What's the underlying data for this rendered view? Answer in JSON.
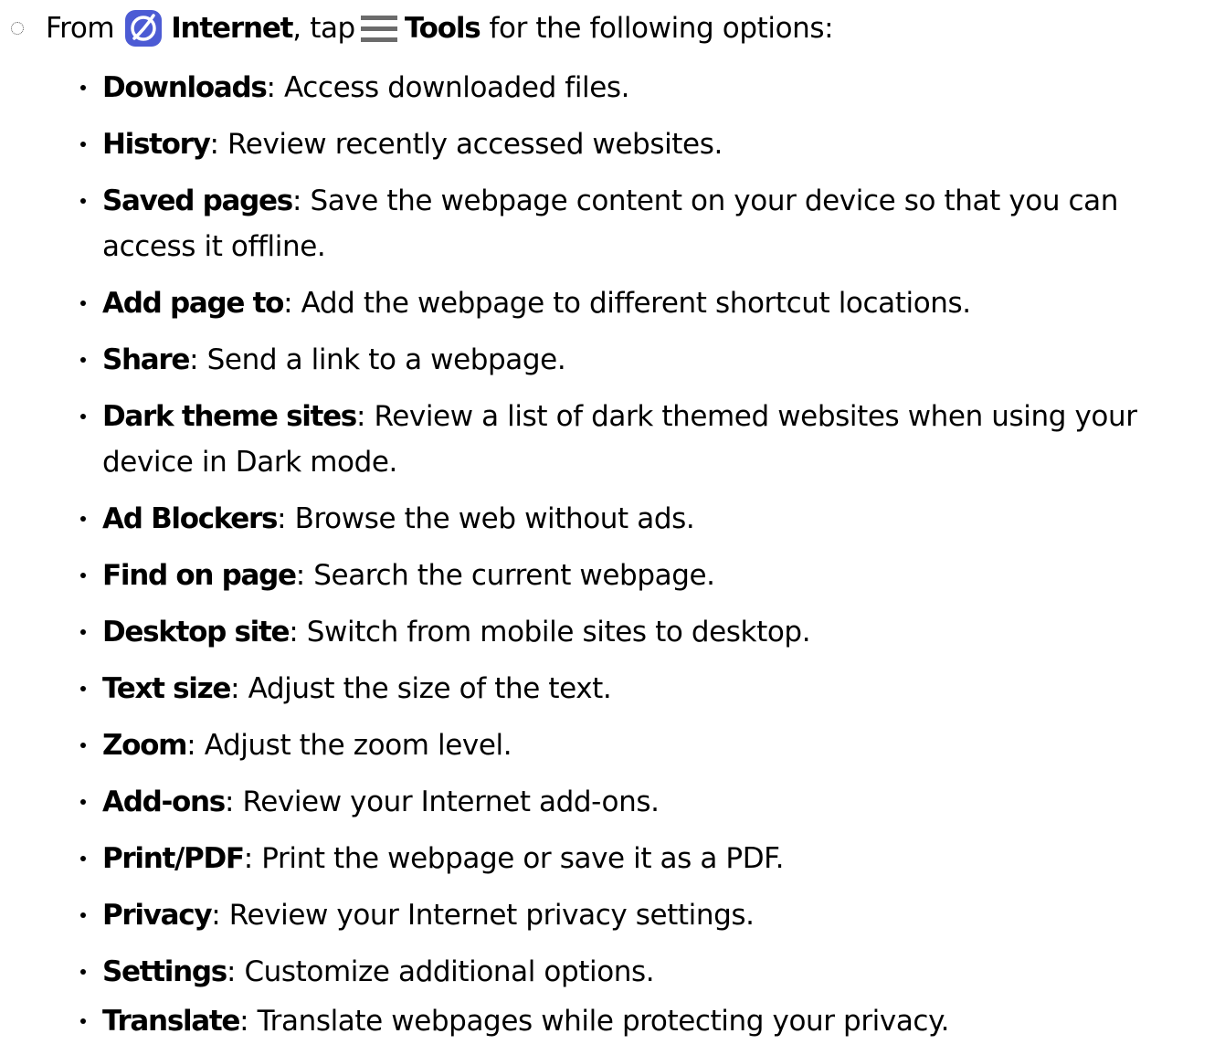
{
  "intro": {
    "from": "From",
    "app_name": "Internet",
    "comma_tap": ", tap",
    "menu_name": "Tools",
    "rest": "for the following options:"
  },
  "icons": {
    "step_marker": "dotted-circle-icon",
    "app": "internet-app-icon",
    "menu": "hamburger-menu-icon"
  },
  "colors": {
    "app_icon_bg": "#4c5bd4",
    "app_icon_ring": "#ffffff",
    "menu_icon": "#6b6b6b"
  },
  "options": [
    {
      "term": "Downloads",
      "desc": "Access downloaded files."
    },
    {
      "term": "History",
      "desc": "Review recently accessed websites."
    },
    {
      "term": "Saved pages",
      "desc": "Save the webpage content on your device so that you can",
      "desc2": "access it offline."
    },
    {
      "term": "Add page to",
      "desc": "Add the webpage to different shortcut locations."
    },
    {
      "term": "Share",
      "desc": "Send a link to a webpage."
    },
    {
      "term": "Dark theme sites",
      "desc": "Review a list of dark themed websites when using your",
      "desc2": "device in Dark mode."
    },
    {
      "term": "Ad Blockers",
      "desc": "Browse the web without ads."
    },
    {
      "term": "Find on page",
      "desc": "Search the current webpage."
    },
    {
      "term": "Desktop site",
      "desc": "Switch from mobile sites to desktop."
    },
    {
      "term": "Text size",
      "desc": "Adjust the size of the text."
    },
    {
      "term": "Zoom",
      "desc": "Adjust the zoom level."
    },
    {
      "term": "Add-ons",
      "desc": "Review your Internet add-ons."
    },
    {
      "term": "Print/PDF",
      "desc": "Print the webpage or save it as a PDF."
    },
    {
      "term": "Privacy",
      "desc": "Review your Internet privacy settings."
    },
    {
      "term": "Settings",
      "desc": "Customize additional options."
    },
    {
      "term": "Translate",
      "desc": "Translate webpages while protecting your privacy."
    }
  ]
}
